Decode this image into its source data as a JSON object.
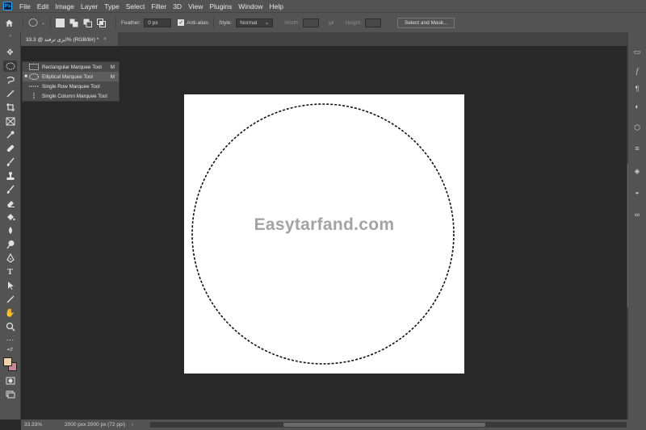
{
  "menubar": {
    "logo": "Ps",
    "items": [
      "File",
      "Edit",
      "Image",
      "Layer",
      "Type",
      "Select",
      "Filter",
      "3D",
      "View",
      "Plugins",
      "Window",
      "Help"
    ]
  },
  "options_bar": {
    "feather_label": "Feather:",
    "feather_value": "0 px",
    "antialias_label": "Anti-alias",
    "antialias_checked": true,
    "style_label": "Style:",
    "style_value": "Normal",
    "width_label": "Width:",
    "height_label": "Height:",
    "select_mask_label": "Select and Mask..."
  },
  "document_tab": {
    "title": "33.3 @ ایزی ترفند% (RGB/8#) *",
    "close": "×"
  },
  "flyout": {
    "items": [
      {
        "label": "Rectangular Marquee Tool",
        "shortcut": "M",
        "active": false
      },
      {
        "label": "Elliptical Marquee Tool",
        "shortcut": "M",
        "active": true
      },
      {
        "label": "Single Row Marquee Tool",
        "shortcut": "",
        "active": false
      },
      {
        "label": "Single Column Marquee Tool",
        "shortcut": "",
        "active": false
      }
    ]
  },
  "canvas": {
    "watermark": "Easytarfand.com"
  },
  "status_bar": {
    "zoom": "33.33%",
    "doc_info": "2000 pxx 2000 px (72 ppi)"
  },
  "colors": {
    "foreground": "#f2d3a8",
    "background": "#c98a97",
    "ui_panel": "#535353",
    "workspace": "#282828"
  }
}
